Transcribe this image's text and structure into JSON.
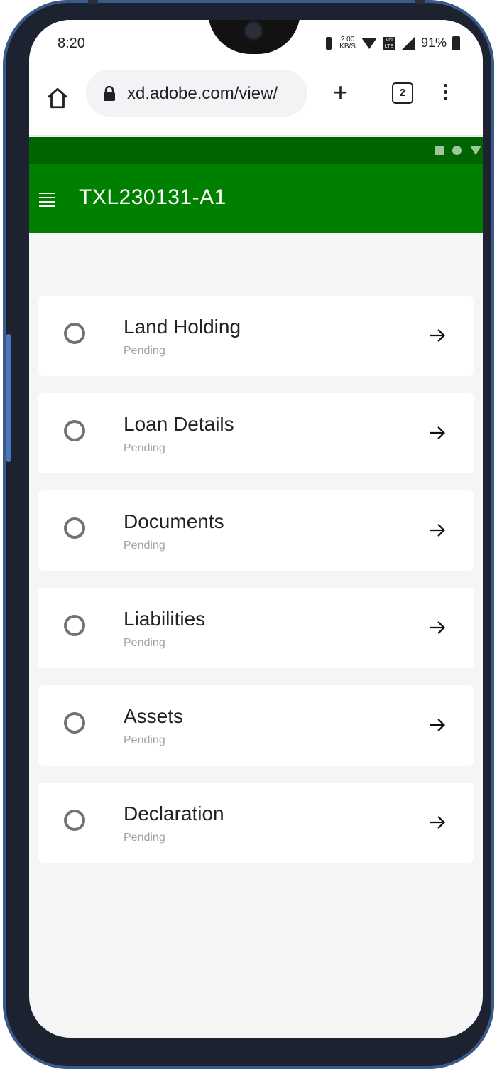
{
  "status_bar": {
    "time": "8:20",
    "net_speed_top": "2.00",
    "net_speed_bottom": "KB/S",
    "volte": "Vol LTE",
    "battery": "91%"
  },
  "browser": {
    "url": "xd.adobe.com/view/",
    "tab_count": "2"
  },
  "app_bar": {
    "title": "TXL230131-A1"
  },
  "items": [
    {
      "title": "Land Holding",
      "status": "Pending"
    },
    {
      "title": "Loan Details",
      "status": "Pending"
    },
    {
      "title": "Documents",
      "status": "Pending"
    },
    {
      "title": "Liabilities",
      "status": "Pending"
    },
    {
      "title": "Assets",
      "status": "Pending"
    },
    {
      "title": "Declaration",
      "status": "Pending"
    }
  ],
  "colors": {
    "app_status_bar": "#006400",
    "toolbar": "#008000",
    "background": "#f5f5f5"
  }
}
